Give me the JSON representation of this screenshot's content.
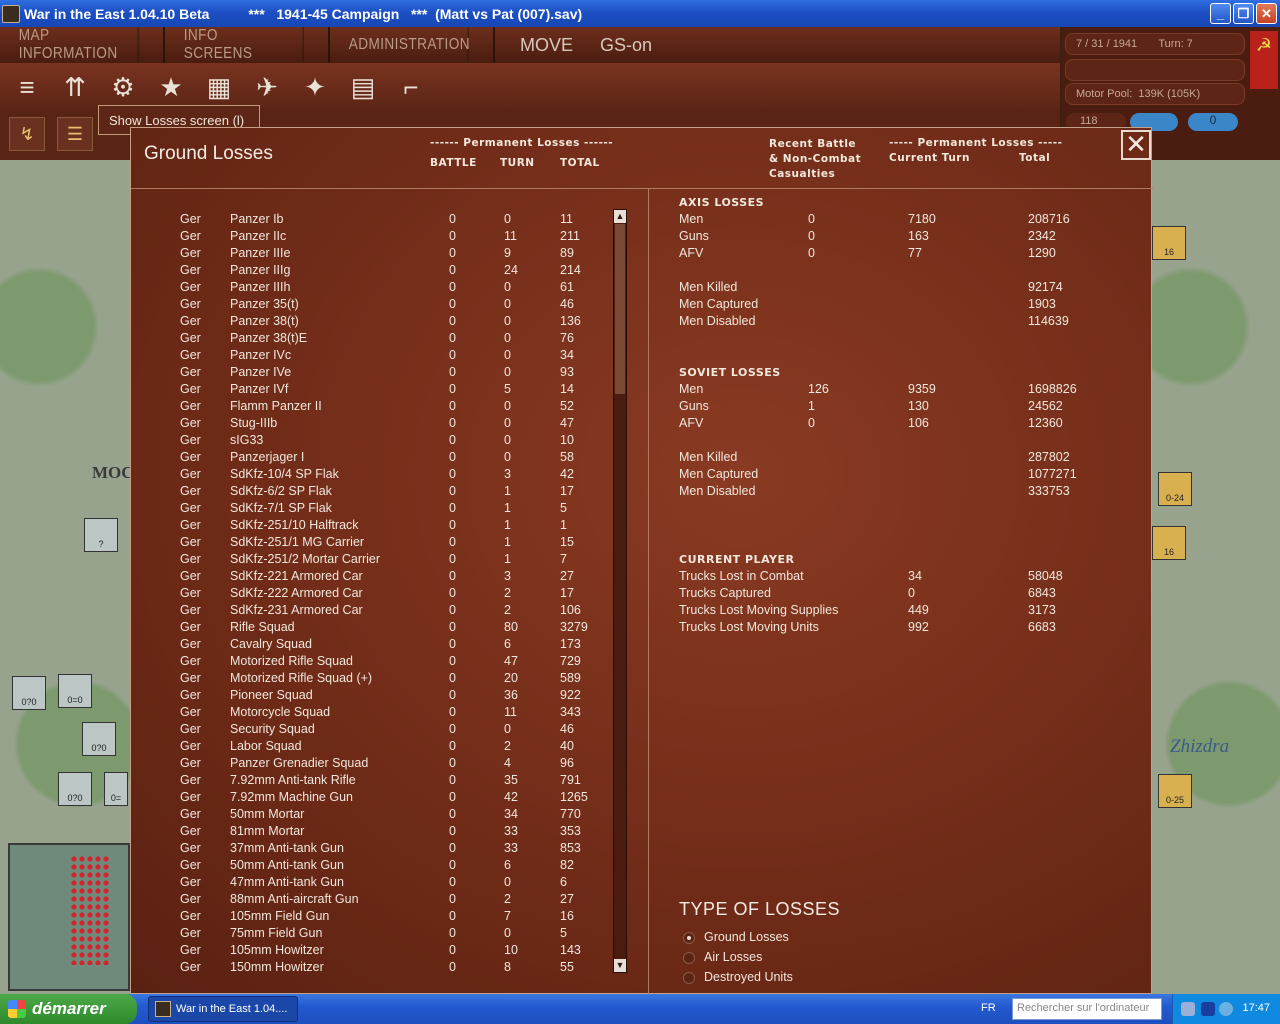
{
  "window": {
    "title": "War in the East 1.04.10 Beta          ***   1941-45 Campaign   ***  (Matt vs Pat (007).sav)"
  },
  "menu": {
    "tabs": [
      "MAP INFORMATION",
      "INFO SCREENS",
      "ADMINISTRATION"
    ],
    "mode": "MOVE",
    "gs": "GS-on"
  },
  "info": {
    "date_turn": "7 / 31 / 1941       Turn: 7",
    "motor_pool": "Motor Pool:  139K (105K)",
    "count": "118",
    "pill_value": "0"
  },
  "tooltip": "Show Losses screen (l)",
  "map": {
    "city_label": "MOC",
    "zhizdra": "Zhizdra",
    "counters": [
      "0-24",
      "16",
      "16",
      "0-25",
      "?",
      "0?0",
      "0=0",
      "0?0",
      "0?0",
      "0="
    ]
  },
  "dialog": {
    "title": "Ground Losses",
    "left_header_top": "------ Permanent Losses ------",
    "col_battle": "BATTLE",
    "col_turn": "TURN",
    "col_total": "TOTAL",
    "right_header_recent": "Recent Battle\n& Non-Combat\nCasualties",
    "right_header_perm": "----- Permanent Losses -----",
    "right_header_current": "Current Turn",
    "right_header_total": "Total",
    "rows": [
      [
        "Ger",
        "Panzer Ib",
        "0",
        "0",
        "11"
      ],
      [
        "Ger",
        "Panzer IIc",
        "0",
        "11",
        "211"
      ],
      [
        "Ger",
        "Panzer IIIe",
        "0",
        "9",
        "89"
      ],
      [
        "Ger",
        "Panzer IIIg",
        "0",
        "24",
        "214"
      ],
      [
        "Ger",
        "Panzer IIIh",
        "0",
        "0",
        "61"
      ],
      [
        "Ger",
        "Panzer 35(t)",
        "0",
        "0",
        "46"
      ],
      [
        "Ger",
        "Panzer 38(t)",
        "0",
        "0",
        "136"
      ],
      [
        "Ger",
        "Panzer 38(t)E",
        "0",
        "0",
        "76"
      ],
      [
        "Ger",
        "Panzer IVc",
        "0",
        "0",
        "34"
      ],
      [
        "Ger",
        "Panzer IVe",
        "0",
        "0",
        "93"
      ],
      [
        "Ger",
        "Panzer IVf",
        "0",
        "5",
        "14"
      ],
      [
        "Ger",
        "Flamm Panzer II",
        "0",
        "0",
        "52"
      ],
      [
        "Ger",
        "Stug-IIIb",
        "0",
        "0",
        "47"
      ],
      [
        "Ger",
        "sIG33",
        "0",
        "0",
        "10"
      ],
      [
        "Ger",
        "Panzerjager I",
        "0",
        "0",
        "58"
      ],
      [
        "Ger",
        "SdKfz-10/4 SP Flak",
        "0",
        "3",
        "42"
      ],
      [
        "Ger",
        "SdKfz-6/2 SP Flak",
        "0",
        "1",
        "17"
      ],
      [
        "Ger",
        "SdKfz-7/1 SP Flak",
        "0",
        "1",
        "5"
      ],
      [
        "Ger",
        "SdKfz-251/10 Halftrack",
        "0",
        "1",
        "1"
      ],
      [
        "Ger",
        "SdKfz-251/1 MG Carrier",
        "0",
        "1",
        "15"
      ],
      [
        "Ger",
        "SdKfz-251/2 Mortar Carrier",
        "0",
        "1",
        "7"
      ],
      [
        "Ger",
        "SdKfz-221 Armored Car",
        "0",
        "3",
        "27"
      ],
      [
        "Ger",
        "SdKfz-222 Armored Car",
        "0",
        "2",
        "17"
      ],
      [
        "Ger",
        "SdKfz-231 Armored Car",
        "0",
        "2",
        "106"
      ],
      [
        "Ger",
        "Rifle Squad",
        "0",
        "80",
        "3279"
      ],
      [
        "Ger",
        "Cavalry Squad",
        "0",
        "6",
        "173"
      ],
      [
        "Ger",
        "Motorized Rifle Squad",
        "0",
        "47",
        "729"
      ],
      [
        "Ger",
        "Motorized Rifle Squad (+)",
        "0",
        "20",
        "589"
      ],
      [
        "Ger",
        "Pioneer Squad",
        "0",
        "36",
        "922"
      ],
      [
        "Ger",
        "Motorcycle Squad",
        "0",
        "11",
        "343"
      ],
      [
        "Ger",
        "Security Squad",
        "0",
        "0",
        "46"
      ],
      [
        "Ger",
        "Labor Squad",
        "0",
        "2",
        "40"
      ],
      [
        "Ger",
        "Panzer Grenadier Squad",
        "0",
        "4",
        "96"
      ],
      [
        "Ger",
        "7.92mm Anti-tank Rifle",
        "0",
        "35",
        "791"
      ],
      [
        "Ger",
        "7.92mm Machine Gun",
        "0",
        "42",
        "1265"
      ],
      [
        "Ger",
        "50mm Mortar",
        "0",
        "34",
        "770"
      ],
      [
        "Ger",
        "81mm Mortar",
        "0",
        "33",
        "353"
      ],
      [
        "Ger",
        "37mm Anti-tank Gun",
        "0",
        "33",
        "853"
      ],
      [
        "Ger",
        "50mm Anti-tank Gun",
        "0",
        "6",
        "82"
      ],
      [
        "Ger",
        "47mm Anti-tank Gun",
        "0",
        "0",
        "6"
      ],
      [
        "Ger",
        "88mm Anti-aircraft Gun",
        "0",
        "2",
        "27"
      ],
      [
        "Ger",
        "105mm Field Gun",
        "0",
        "7",
        "16"
      ],
      [
        "Ger",
        "75mm Field Gun",
        "0",
        "0",
        "5"
      ],
      [
        "Ger",
        "105mm Howitzer",
        "0",
        "10",
        "143"
      ],
      [
        "Ger",
        "150mm Howitzer",
        "0",
        "8",
        "55"
      ]
    ],
    "axis": {
      "title": "AXIS LOSSES",
      "rows": [
        [
          "Men",
          "0",
          "7180",
          "208716"
        ],
        [
          "Guns",
          "0",
          "163",
          "2342"
        ],
        [
          "AFV",
          "0",
          "77",
          "1290"
        ]
      ],
      "details": [
        [
          "Men Killed",
          "92174"
        ],
        [
          "Men Captured",
          "1903"
        ],
        [
          "Men Disabled",
          "114639"
        ]
      ]
    },
    "soviet": {
      "title": "SOVIET LOSSES",
      "rows": [
        [
          "Men",
          "126",
          "9359",
          "1698826"
        ],
        [
          "Guns",
          "1",
          "130",
          "24562"
        ],
        [
          "AFV",
          "0",
          "106",
          "12360"
        ]
      ],
      "details": [
        [
          "Men Killed",
          "287802"
        ],
        [
          "Men Captured",
          "1077271"
        ],
        [
          "Men Disabled",
          "333753"
        ]
      ]
    },
    "current_player": {
      "title": "CURRENT PLAYER",
      "rows": [
        [
          "Trucks Lost in Combat",
          "34",
          "58048"
        ],
        [
          "Trucks Captured",
          "0",
          "6843"
        ],
        [
          "Trucks Lost Moving Supplies",
          "449",
          "3173"
        ],
        [
          "Trucks Lost Moving Units",
          "992",
          "6683"
        ]
      ]
    },
    "type_of_losses": {
      "title": "TYPE OF LOSSES",
      "options": [
        "Ground Losses",
        "Air Losses",
        "Destroyed Units"
      ],
      "selected": 0
    }
  },
  "taskbar": {
    "start": "démarrer",
    "task": "War in the East 1.04....",
    "lang": "FR",
    "search_placeholder": "Rechercher sur l'ordinateur",
    "clock": "17:47"
  }
}
